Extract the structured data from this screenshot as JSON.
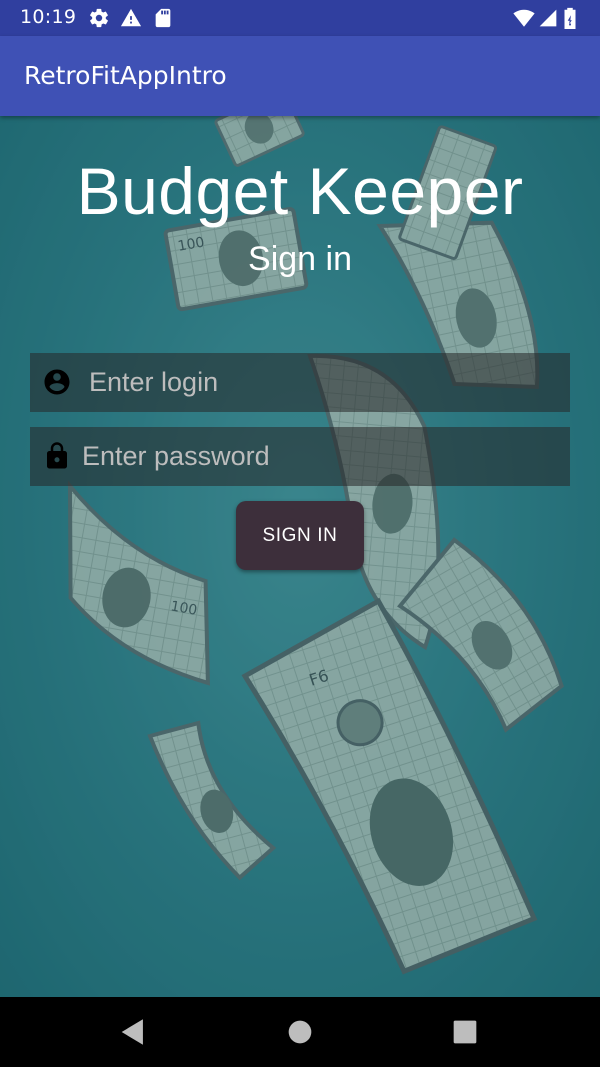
{
  "status_bar": {
    "time": "10:19",
    "icons_left": [
      "gear-icon",
      "warning-icon",
      "sd-card-icon"
    ],
    "icons_right": [
      "wifi-icon",
      "signal-icon",
      "battery-icon"
    ]
  },
  "app_bar": {
    "title": "RetroFitAppIntro",
    "color": "#3f51b5"
  },
  "main": {
    "title": "Budget Keeper",
    "subtitle": "Sign in",
    "login_field": {
      "placeholder": "Enter login",
      "value": "",
      "icon": "account-circle-icon"
    },
    "password_field": {
      "placeholder": "Enter password",
      "value": "",
      "icon": "lock-icon"
    },
    "signin_button": {
      "label": "SIGN IN"
    }
  },
  "nav_bar": {
    "buttons": [
      "back-icon",
      "home-icon",
      "recents-icon"
    ]
  }
}
